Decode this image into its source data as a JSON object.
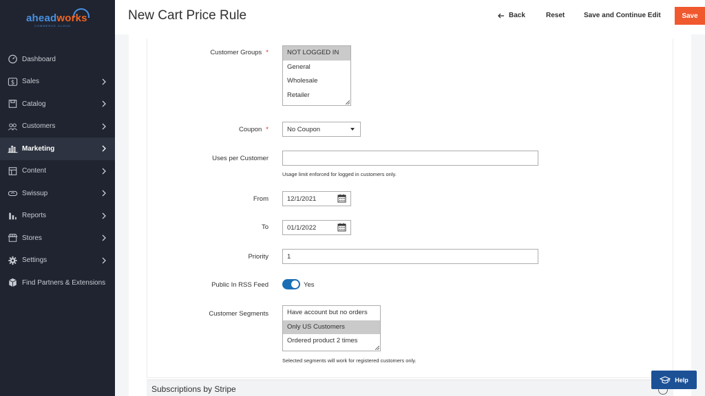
{
  "sidebar": {
    "logo": {
      "part1": "ahead",
      "part2": "works",
      "tagline": "COMMERCE CLOUD"
    },
    "items": [
      {
        "label": "Dashboard",
        "icon": "dashboard-icon",
        "has_children": false,
        "active": false
      },
      {
        "label": "Sales",
        "icon": "dollar-icon",
        "has_children": true,
        "active": false
      },
      {
        "label": "Catalog",
        "icon": "box-icon",
        "has_children": true,
        "active": false
      },
      {
        "label": "Customers",
        "icon": "users-icon",
        "has_children": true,
        "active": false
      },
      {
        "label": "Marketing",
        "icon": "bar-chart-icon",
        "has_children": true,
        "active": true
      },
      {
        "label": "Content",
        "icon": "layout-icon",
        "has_children": true,
        "active": false
      },
      {
        "label": "Swissup",
        "icon": "infinity-icon",
        "has_children": true,
        "active": false
      },
      {
        "label": "Reports",
        "icon": "reports-icon",
        "has_children": true,
        "active": false
      },
      {
        "label": "Stores",
        "icon": "store-icon",
        "has_children": true,
        "active": false
      },
      {
        "label": "Settings",
        "icon": "gear-icon",
        "has_children": true,
        "active": false
      },
      {
        "label": "Find Partners & Extensions",
        "icon": "cubes-icon",
        "has_children": false,
        "active": false
      }
    ]
  },
  "header": {
    "title": "New Cart Price Rule",
    "back_label": "Back",
    "reset_label": "Reset",
    "save_continue_label": "Save and Continue Edit",
    "save_label": "Save"
  },
  "form": {
    "customer_groups": {
      "label": "Customer Groups",
      "required": "*",
      "options": [
        "NOT LOGGED IN",
        "General",
        "Wholesale",
        "Retailer"
      ],
      "selected": "NOT LOGGED IN"
    },
    "coupon": {
      "label": "Coupon",
      "required": "*",
      "value": "No Coupon"
    },
    "uses_per_customer": {
      "label": "Uses per Customer",
      "value": "",
      "note": "Usage limit enforced for logged in customers only."
    },
    "from": {
      "label": "From",
      "value": "12/1/2021"
    },
    "to": {
      "label": "To",
      "value": "01/1/2022"
    },
    "priority": {
      "label": "Priority",
      "value": "1"
    },
    "rss": {
      "label": "Public In RSS Feed",
      "value": "Yes",
      "enabled": true
    },
    "segments": {
      "label": "Customer Segments",
      "options": [
        "Have account but no orders",
        "Only US Customers",
        "Ordered product 2 times"
      ],
      "selected": "Only US Customers",
      "note": "Selected segments will work for registered customers only."
    }
  },
  "section": {
    "title": "Subscriptions by Stripe"
  },
  "help": {
    "label": "Help"
  },
  "colors": {
    "sidebar_bg": "#1f2430",
    "accent_orange": "#f0582e",
    "toggle_blue": "#1a6eb5",
    "help_blue": "#1c5196"
  }
}
